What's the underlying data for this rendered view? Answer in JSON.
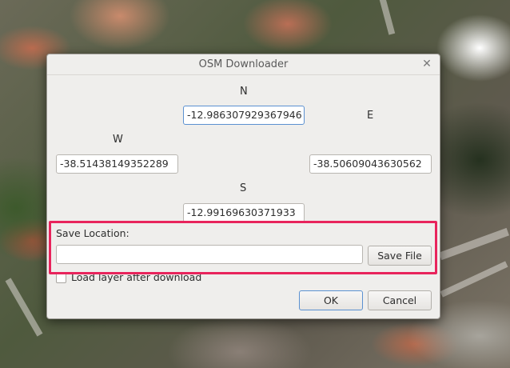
{
  "dialog": {
    "title": "OSM Downloader",
    "close_icon": "close-icon"
  },
  "bounds": {
    "north_label": "N",
    "north_value": "-12.986307929367946",
    "east_label": "E",
    "east_value": "-38.50609043630562",
    "west_label": "W",
    "west_value": "-38.51438149352289",
    "south_label": "S",
    "south_value": "-12.99169630371933"
  },
  "save": {
    "label": "Save Location:",
    "path_value": "",
    "button_label": "Save File"
  },
  "load_layer": {
    "label": "Load layer after download",
    "checked": false
  },
  "actions": {
    "ok_label": "OK",
    "cancel_label": "Cancel"
  },
  "colors": {
    "highlight": "#e8245c",
    "focus": "#5b91d1"
  }
}
